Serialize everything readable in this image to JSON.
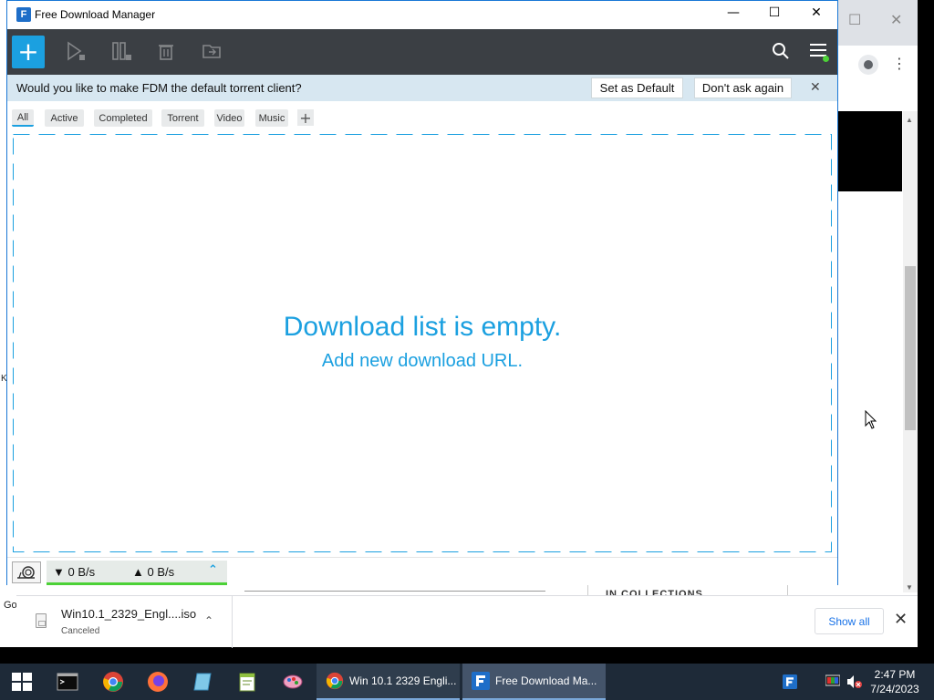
{
  "fdm": {
    "window_title": "Free Download Manager",
    "window_controls": {
      "minimize": "—",
      "maximize": "☐",
      "close": "✕"
    },
    "toolbar": {
      "add_label": "+"
    },
    "banner": {
      "message": "Would you like to make FDM the default torrent client?",
      "set_default_label": "Set as Default",
      "dont_ask_label": "Don't ask again",
      "close_label": "✕"
    },
    "tabs": [
      "All",
      "Active",
      "Completed",
      "Torrent",
      "Video",
      "Music"
    ],
    "tab_add_label": "+",
    "empty_title": "Download list is empty.",
    "empty_subtitle": "Add new download URL.",
    "status": {
      "download_speed": "▼ 0 B/s",
      "upload_speed": "▲ 0 B/s",
      "expand_label": "⌃"
    },
    "accent_color": "#1ba0e0"
  },
  "background_browser": {
    "left_fragment": "K",
    "bottom_fragment": "Go",
    "section_label": "IN COLLECTIONS"
  },
  "downloads_shelf": {
    "file_name": "Win10.1_2329_Engl....iso",
    "file_status": "Canceled",
    "show_all_label": "Show all",
    "close_label": "✕"
  },
  "taskbar": {
    "tasks": [
      {
        "label": "Win 10.1 2329 Engli...",
        "icon": "chrome-icon"
      },
      {
        "label": "Free Download Ma...",
        "icon": "fdm-icon",
        "active": true
      }
    ],
    "clock_time": "2:47 PM",
    "clock_date": "7/24/2023"
  }
}
